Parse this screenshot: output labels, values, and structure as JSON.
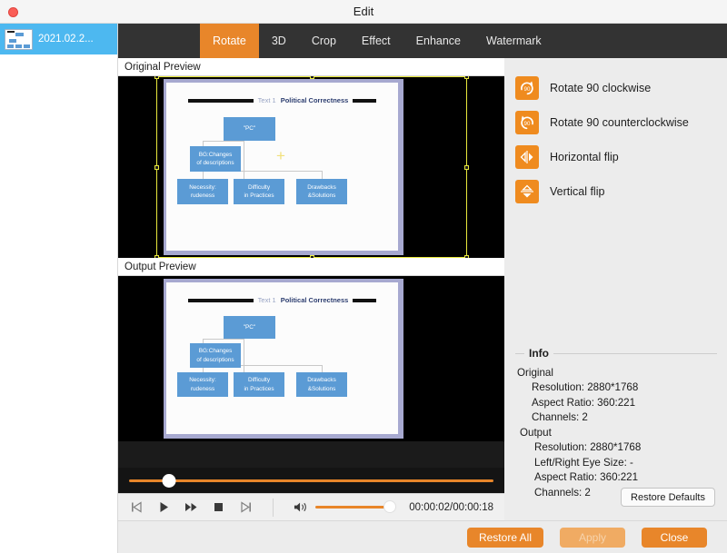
{
  "window": {
    "title": "Edit",
    "close_icon": "close-button"
  },
  "filelist": {
    "items": [
      {
        "name": "2021.02.2...",
        "thumb_icon": "slide-thumbnail"
      }
    ]
  },
  "tabs": [
    {
      "label": "Rotate",
      "active": true
    },
    {
      "label": "3D",
      "active": false
    },
    {
      "label": "Crop",
      "active": false
    },
    {
      "label": "Effect",
      "active": false
    },
    {
      "label": "Enhance",
      "active": false
    },
    {
      "label": "Watermark",
      "active": false
    }
  ],
  "previews": {
    "original_label": "Original Preview",
    "output_label": "Output Preview"
  },
  "slide": {
    "header_prefix": "Text 1",
    "header_title": "Political Correctness",
    "nodes": [
      {
        "lines": [
          "\"PC\""
        ]
      },
      {
        "lines": [
          "BG:Changes",
          "of descriptions"
        ]
      },
      {
        "lines": [
          "Necessity:",
          "rudeness"
        ]
      },
      {
        "lines": [
          "Difficulty",
          "in Practices"
        ]
      },
      {
        "lines": [
          "Drawbacks",
          "&Solutions"
        ]
      }
    ],
    "marker": "+"
  },
  "timeline": {
    "position_percent": 11
  },
  "transport": {
    "buttons": [
      {
        "icon": "previous-icon"
      },
      {
        "icon": "play-icon"
      },
      {
        "icon": "fast-forward-icon"
      },
      {
        "icon": "stop-icon"
      },
      {
        "icon": "next-icon"
      }
    ],
    "volume_icon": "volume-icon",
    "volume_percent": 100,
    "timecode": "00:00:02/00:00:18"
  },
  "rotate_options": [
    {
      "label": "Rotate 90 clockwise",
      "icon": "rotate-cw-90-icon"
    },
    {
      "label": "Rotate 90 counterclockwise",
      "icon": "rotate-ccw-90-icon"
    },
    {
      "label": "Horizontal flip",
      "icon": "horizontal-flip-icon"
    },
    {
      "label": "Vertical flip",
      "icon": "vertical-flip-icon"
    }
  ],
  "info": {
    "legend": "Info",
    "original_heading": "Original",
    "original": [
      "Resolution: 2880*1768",
      "Aspect Ratio: 360:221",
      "Channels: 2"
    ],
    "output_heading": "Output",
    "output": [
      "Resolution: 2880*1768",
      "Left/Right Eye Size: -",
      "Aspect Ratio: 360:221",
      "Channels: 2"
    ],
    "restore_defaults_label": "Restore Defaults"
  },
  "actions": {
    "restore_all": "Restore All",
    "apply": "Apply",
    "close": "Close"
  },
  "colors": {
    "accent_orange": "#e8862a",
    "icon_orange": "#ef8b1f",
    "tabbar_dark": "#333333",
    "selection_yellow": "#e8e83c",
    "node_blue": "#5b9bd5",
    "highlight_blue": "#4db8f0"
  }
}
